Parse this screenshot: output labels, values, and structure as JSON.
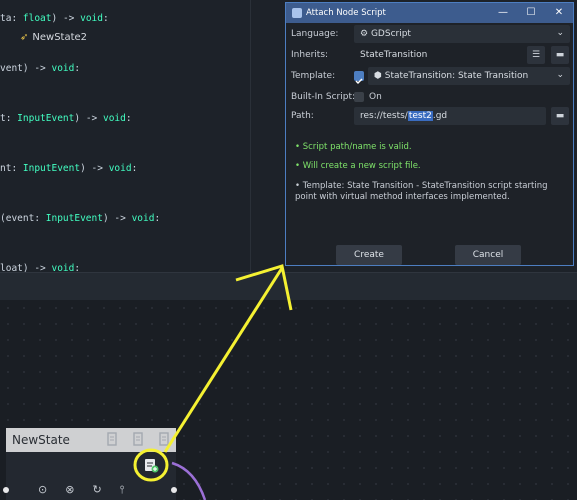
{
  "code": {
    "lines": [
      {
        "pre": "ta: ",
        "type": "float",
        "post": ") -> ",
        "ret": "void",
        "end": ":"
      },
      {
        "pre": "vent) -> ",
        "type": "",
        "post": "",
        "ret": "void",
        "end": ":"
      },
      {
        "pre": "t: ",
        "type": "InputEvent",
        "post": ") -> ",
        "ret": "void",
        "end": ":"
      },
      {
        "pre": "nt: ",
        "type": "InputEvent",
        "post": ") -> ",
        "ret": "void",
        "end": ":"
      },
      {
        "pre": "(event: ",
        "type": "InputEvent",
        "post": ") -> ",
        "ret": "void",
        "end": ":"
      },
      {
        "pre": "loat) -> ",
        "type": "",
        "post": "",
        "ret": "void",
        "end": ":"
      }
    ]
  },
  "dialog": {
    "title": "Attach Node Script",
    "controls": {
      "minimize": "—",
      "maximize": "☐",
      "close": "✕"
    },
    "language": {
      "label": "Language:",
      "value": "GDScript"
    },
    "inherits": {
      "label": "Inherits:",
      "value": "StateTransition"
    },
    "template": {
      "label": "Template:",
      "value": "StateTransition: State Transition",
      "checked": true
    },
    "builtin": {
      "label": "Built-In Script:",
      "value": "On",
      "checked": false
    },
    "path": {
      "label": "Path:",
      "value_pre": "res://tests/",
      "value_sel": "test2",
      "value_post": ".gd"
    },
    "messages": {
      "valid": "Script path/name is valid.",
      "new_file": "Will create a new script file.",
      "template_info": "Template: State Transition - StateTransition script starting point with virtual method interfaces implemented."
    },
    "buttons": {
      "create": "Create",
      "cancel": "Cancel"
    }
  },
  "node": {
    "title": "NewState",
    "state_label": "NewState2"
  },
  "colors": {
    "accent": "#4d7ec1",
    "annotation": "#f5f132",
    "connection": "#9b6fd6"
  }
}
